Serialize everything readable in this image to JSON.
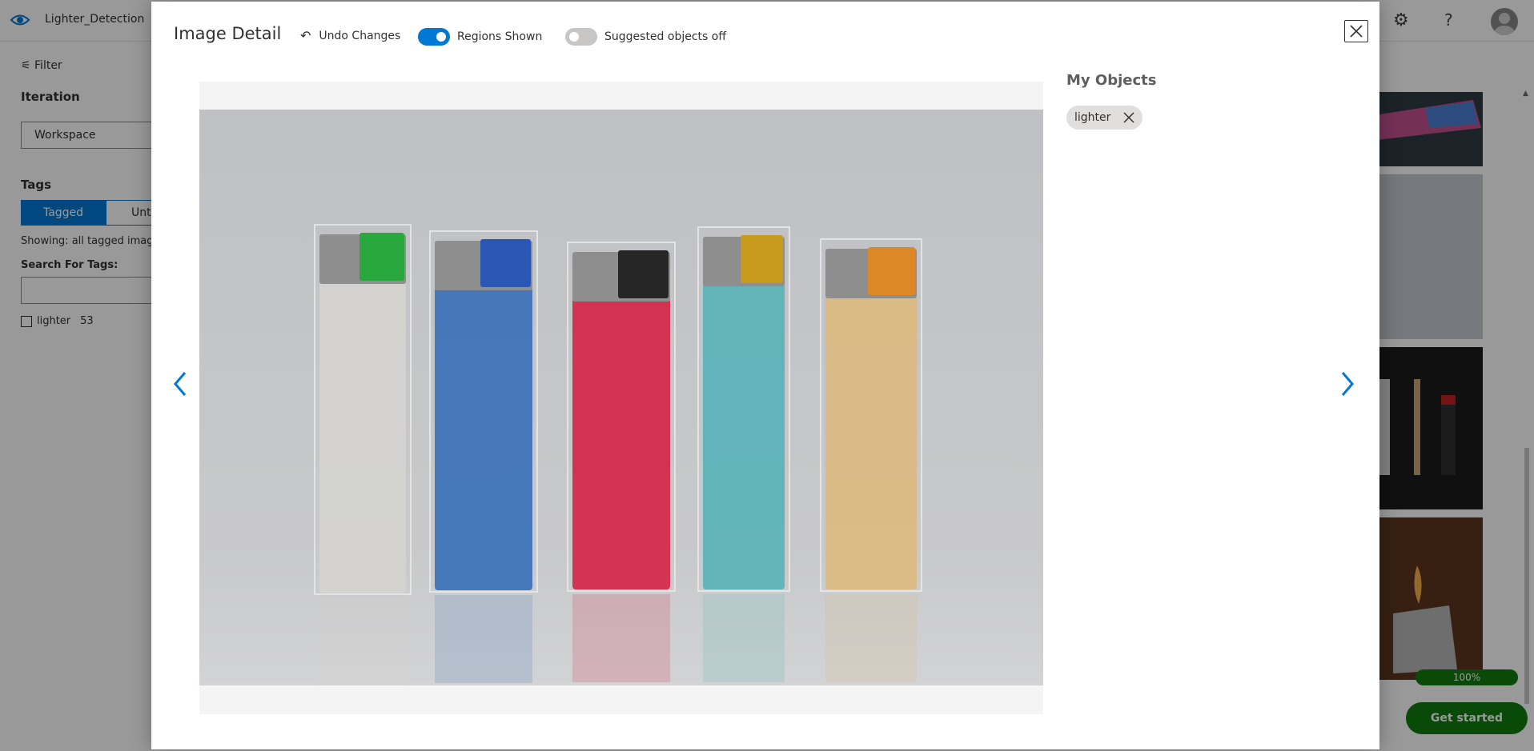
{
  "app": {
    "project_name": "Lighter_Detection",
    "icons": {
      "logo": "eye-icon",
      "settings": "gear-icon",
      "help": "question-icon",
      "avatar": "user-avatar"
    }
  },
  "sidebar": {
    "filter_label": "Filter",
    "iteration_label": "Iteration",
    "iteration_value": "Workspace",
    "tags_label": "Tags",
    "tagged_tab": "Tagged",
    "untagged_tab": "Untag",
    "showing_text": "Showing: all tagged image",
    "search_label": "Search For Tags:",
    "tag_list": [
      {
        "name": "lighter",
        "count": "53"
      }
    ]
  },
  "background": {
    "progress": "100%",
    "get_started": "Get started"
  },
  "modal": {
    "title": "Image Detail",
    "undo_label": "Undo Changes",
    "regions_label": "Regions Shown",
    "regions_on": true,
    "suggested_label": "Suggested objects off",
    "suggested_on": false,
    "objects_title": "My Objects",
    "objects": [
      {
        "tag": "lighter"
      }
    ],
    "lighter_colors": [
      "#e7e6e2",
      "#3d7ac8",
      "#e8264a",
      "#5fc1c9",
      "#f0c98a"
    ],
    "cap_colors": [
      "#2db843",
      "#2f5fc4",
      "#2a2a2a",
      "#d9a821",
      "#f0932a"
    ]
  }
}
